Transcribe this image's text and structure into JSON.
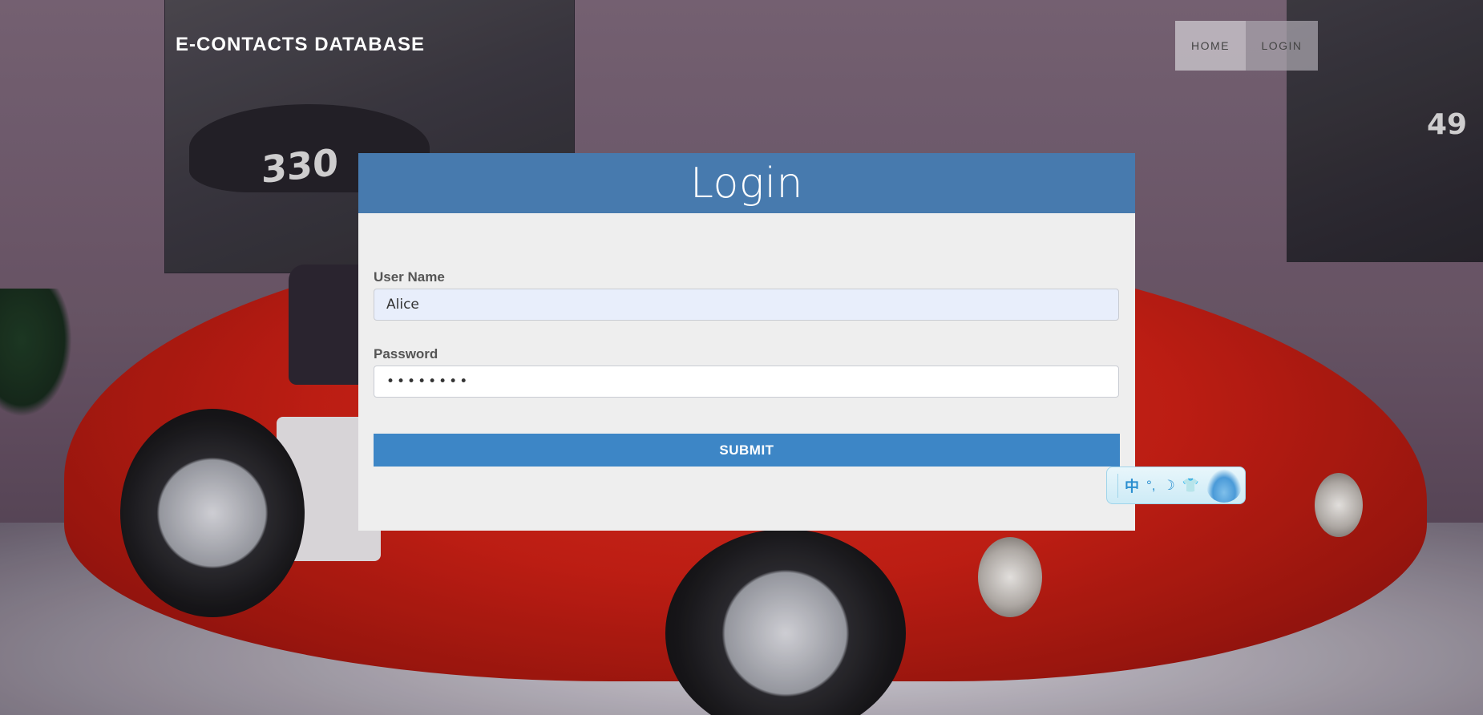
{
  "header": {
    "brand": "E-CONTACTS DATABASE",
    "nav": [
      {
        "label": "HOME"
      },
      {
        "label": "LOGIN"
      }
    ]
  },
  "login_form": {
    "title": "Login",
    "username_label": "User Name",
    "username_value": "Alice",
    "password_label": "Password",
    "password_value": "••••••••",
    "submit_label": "SUBMIT"
  },
  "ime_toolbar": {
    "mode": "中",
    "punct": "°,",
    "moon": "☽",
    "shirt": "👕"
  },
  "colors": {
    "header_bar": "#3870a8",
    "submit_button": "#3d86c6",
    "card_bg": "#eeeeee",
    "username_bg": "#e8eefb"
  }
}
